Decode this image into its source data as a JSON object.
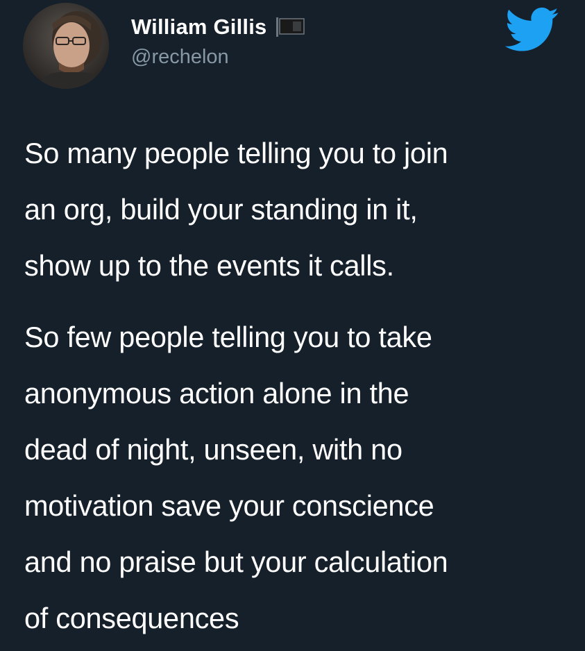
{
  "tweet": {
    "author": {
      "display_name": "William Gillis",
      "handle": "@rechelon",
      "avatar_icon": "profile-photo",
      "badge_icon": "black-flag-icon"
    },
    "platform_icon": "twitter-bird-icon",
    "colors": {
      "background": "#15202b",
      "text": "#ffffff",
      "handle": "#8899a6",
      "accent": "#1da1f2"
    },
    "paragraphs": [
      "So many people telling you to join\nan org, build your standing in it,\nshow up to the events it calls.",
      "So few people telling you to take\nanonymous action alone in the\ndead of night, unseen, with no\nmotivation save your conscience\nand no praise but your calculation\nof consequences"
    ]
  }
}
